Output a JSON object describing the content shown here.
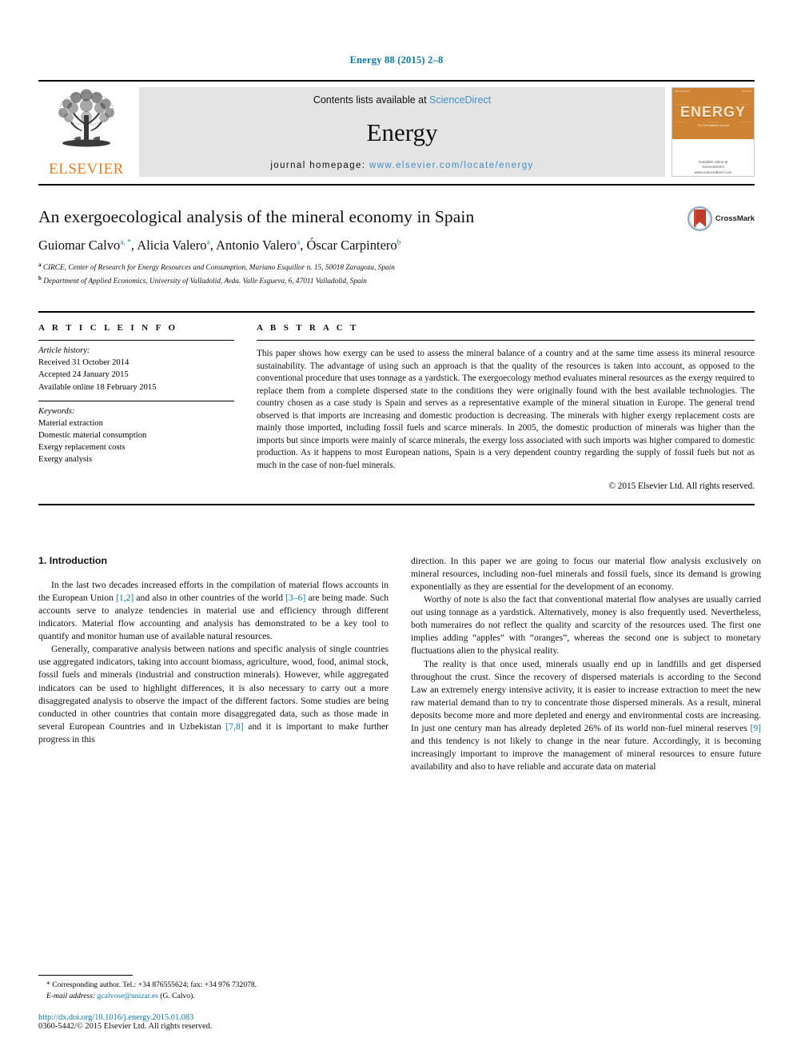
{
  "running_head": "Energy 88 (2015) 2–8",
  "masthead": {
    "publisher_name": "ELSEVIER",
    "contents_prefix": "Contents lists available at ",
    "sciencedirect": "ScienceDirect",
    "journal_name": "Energy",
    "homepage_prefix": "journal homepage: ",
    "homepage_url": "www.elsevier.com/locate/energy",
    "cover": {
      "title": "ENERGY",
      "tagline": "The International Journal",
      "footer": "Available online at\nScienceDirect\nwww.sciencedirect.com",
      "micro_left": "ISSN 0360-5442",
      "micro_right": "Volume 88"
    },
    "accent_orange": "#f07c1e",
    "link_blue": "#3f8fc4",
    "band_gray": "#e4e4e4"
  },
  "article": {
    "title": "An exergoecological analysis of the mineral economy in Spain",
    "authors": [
      {
        "name": "Guiomar Calvo",
        "marks": "a, *"
      },
      {
        "name": "Alicia Valero",
        "marks": "a"
      },
      {
        "name": "Antonio Valero",
        "marks": "a"
      },
      {
        "name": "Óscar Carpintero",
        "marks": "b"
      }
    ],
    "authors_line": "Guiomar Calvo a, *, Alicia Valero a, Antonio Valero a, Óscar Carpintero b",
    "affiliations": [
      {
        "mark": "a",
        "text": "CIRCE, Center of Research for Energy Resources and Consumption, Mariano Esquillor n. 15, 50018 Zaragoza, Spain"
      },
      {
        "mark": "b",
        "text": "Department of Applied Economics, University of Valladolid, Avda. Valle Esgueva, 6, 47011 Valladolid, Spain"
      }
    ],
    "crossmark_label": "CrossMark"
  },
  "article_info": {
    "heading": "A R T I C L E  I N F O",
    "history_label": "Article history:",
    "history": [
      "Received 31 October 2014",
      "Accepted 24 January 2015",
      "Available online 18 February 2015"
    ],
    "keywords_label": "Keywords:",
    "keywords": [
      "Material extraction",
      "Domestic material consumption",
      "Exergy replacement costs",
      "Exergy analysis"
    ]
  },
  "abstract": {
    "heading": "A B S T R A C T",
    "text": "This paper shows how exergy can be used to assess the mineral balance of a country and at the same time assess its mineral resource sustainability. The advantage of using such an approach is that the quality of the resources is taken into account, as opposed to the conventional procedure that uses tonnage as a yardstick. The exergoecology method evaluates mineral resources as the exergy required to replace them from a complete dispersed state to the conditions they were originally found with the best available technologies. The country chosen as a case study is Spain and serves as a representative example of the mineral situation in Europe. The general trend observed is that imports are increasing and domestic production is decreasing. The minerals with higher exergy replacement costs are mainly those imported, including fossil fuels and scarce minerals. In 2005, the domestic production of minerals was higher than the imports but since imports were mainly of scarce minerals, the exergy loss associated with such imports was higher compared to domestic production. As it happens to most European nations, Spain is a very dependent country regarding the supply of fossil fuels but not as much in the case of non-fuel minerals.",
    "copyright": "© 2015 Elsevier Ltd. All rights reserved."
  },
  "body": {
    "section_title": "1. Introduction",
    "left_paragraphs": [
      {
        "parts": [
          {
            "t": "In the last two decades increased efforts in the compilation of material flows accounts in the European Union "
          },
          {
            "t": "[1,2]",
            "link": true
          },
          {
            "t": " and also in other countries of the world "
          },
          {
            "t": "[3–6]",
            "link": true
          },
          {
            "t": " are being made. Such accounts serve to analyze tendencies in material use and efficiency through different indicators. Material flow accounting and analysis has demonstrated to be a key tool to quantify and monitor human use of available natural resources."
          }
        ]
      },
      {
        "parts": [
          {
            "t": "Generally, comparative analysis between nations and specific analysis of single countries use aggregated indicators, taking into account biomass, agriculture, wood, food, animal stock, fossil fuels and minerals (industrial and construction minerals). However, while aggregated indicators can be used to highlight differences, it is also necessary to carry out a more disaggregated analysis to observe the impact of the different factors. Some studies are being conducted in other countries that contain more disaggregated data, such as those made in several European Countries and in Uzbekistan "
          },
          {
            "t": "[7,8]",
            "link": true
          },
          {
            "t": " and it is important to make further progress in this"
          }
        ]
      }
    ],
    "right_paragraphs": [
      {
        "parts": [
          {
            "t": "direction. In this paper we are going to focus our material flow analysis exclusively on mineral resources, including non-fuel minerals and fossil fuels, since its demand is growing exponentially as they are essential for the development of an economy."
          }
        ],
        "continuation": true
      },
      {
        "parts": [
          {
            "t": "Worthy of note is also the fact that conventional material flow analyses are usually carried out using tonnage as a yardstick. Alternatively, money is also frequently used. Nevertheless, both numeraires do not reflect the quality and scarcity of the resources used. The first one implies adding “apples” with “oranges”, whereas the second one is subject to monetary fluctuations alien to the physical reality."
          }
        ]
      },
      {
        "parts": [
          {
            "t": "The reality is that once used, minerals usually end up in landfills and get dispersed throughout the crust. Since the recovery of dispersed materials is according to the Second Law an extremely energy intensive activity, it is easier to increase extraction to meet the new raw material demand than to try to concentrate those dispersed minerals. As a result, mineral deposits become more and more depleted and energy and environmental costs are increasing. In just one century man has already depleted 26% of its world non-fuel mineral reserves "
          },
          {
            "t": "[9]",
            "link": true
          },
          {
            "t": " and this tendency is not likely to change in the near future. Accordingly, it is becoming increasingly important to improve the management of mineral resources to ensure future availability and also to have reliable and accurate data on material"
          }
        ]
      }
    ]
  },
  "footnote": {
    "corresponding": "* Corresponding author. Tel.: +34 876555624; fax: +34 976 732078.",
    "email_label": "E-mail address:",
    "email": "gcalvose@unizar.es",
    "email_suffix": "(G. Calvo).",
    "doi": "http://dx.doi.org/10.1016/j.energy.2015.01.083",
    "issn": "0360-5442/© 2015 Elsevier Ltd. All rights reserved."
  },
  "colors": {
    "link_blue": "#0b7aa8",
    "elsevier_orange": "#f07c1e",
    "cover_orange": "#cf8434",
    "crossmark_red": "#c0392b"
  }
}
